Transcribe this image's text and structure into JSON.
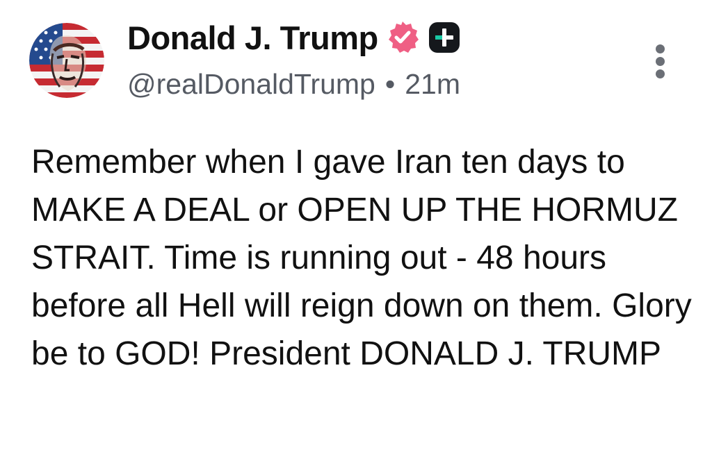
{
  "author": {
    "display_name": "Donald J. Trump",
    "handle": "@realDonaldTrump",
    "separator": "•",
    "time_ago": "21m",
    "avatar_icon": "flag-portrait-avatar",
    "badges": [
      "verified-badge-icon",
      "plus-badge-icon"
    ]
  },
  "post": {
    "text": "Remember when I gave Iran ten days to MAKE A DEAL or OPEN UP THE HORMUZ STRAIT. Time is running out - 48 hours before all Hell will reign down on them. Glory be to GOD! President DONALD J. TRUMP"
  },
  "menu": {
    "icon": "more-vertical-icon"
  },
  "colors": {
    "verified": "#ef5f84",
    "plus_badge": "#15181c",
    "plus_accent": "#19c9a5",
    "meta_text": "#555a63"
  }
}
